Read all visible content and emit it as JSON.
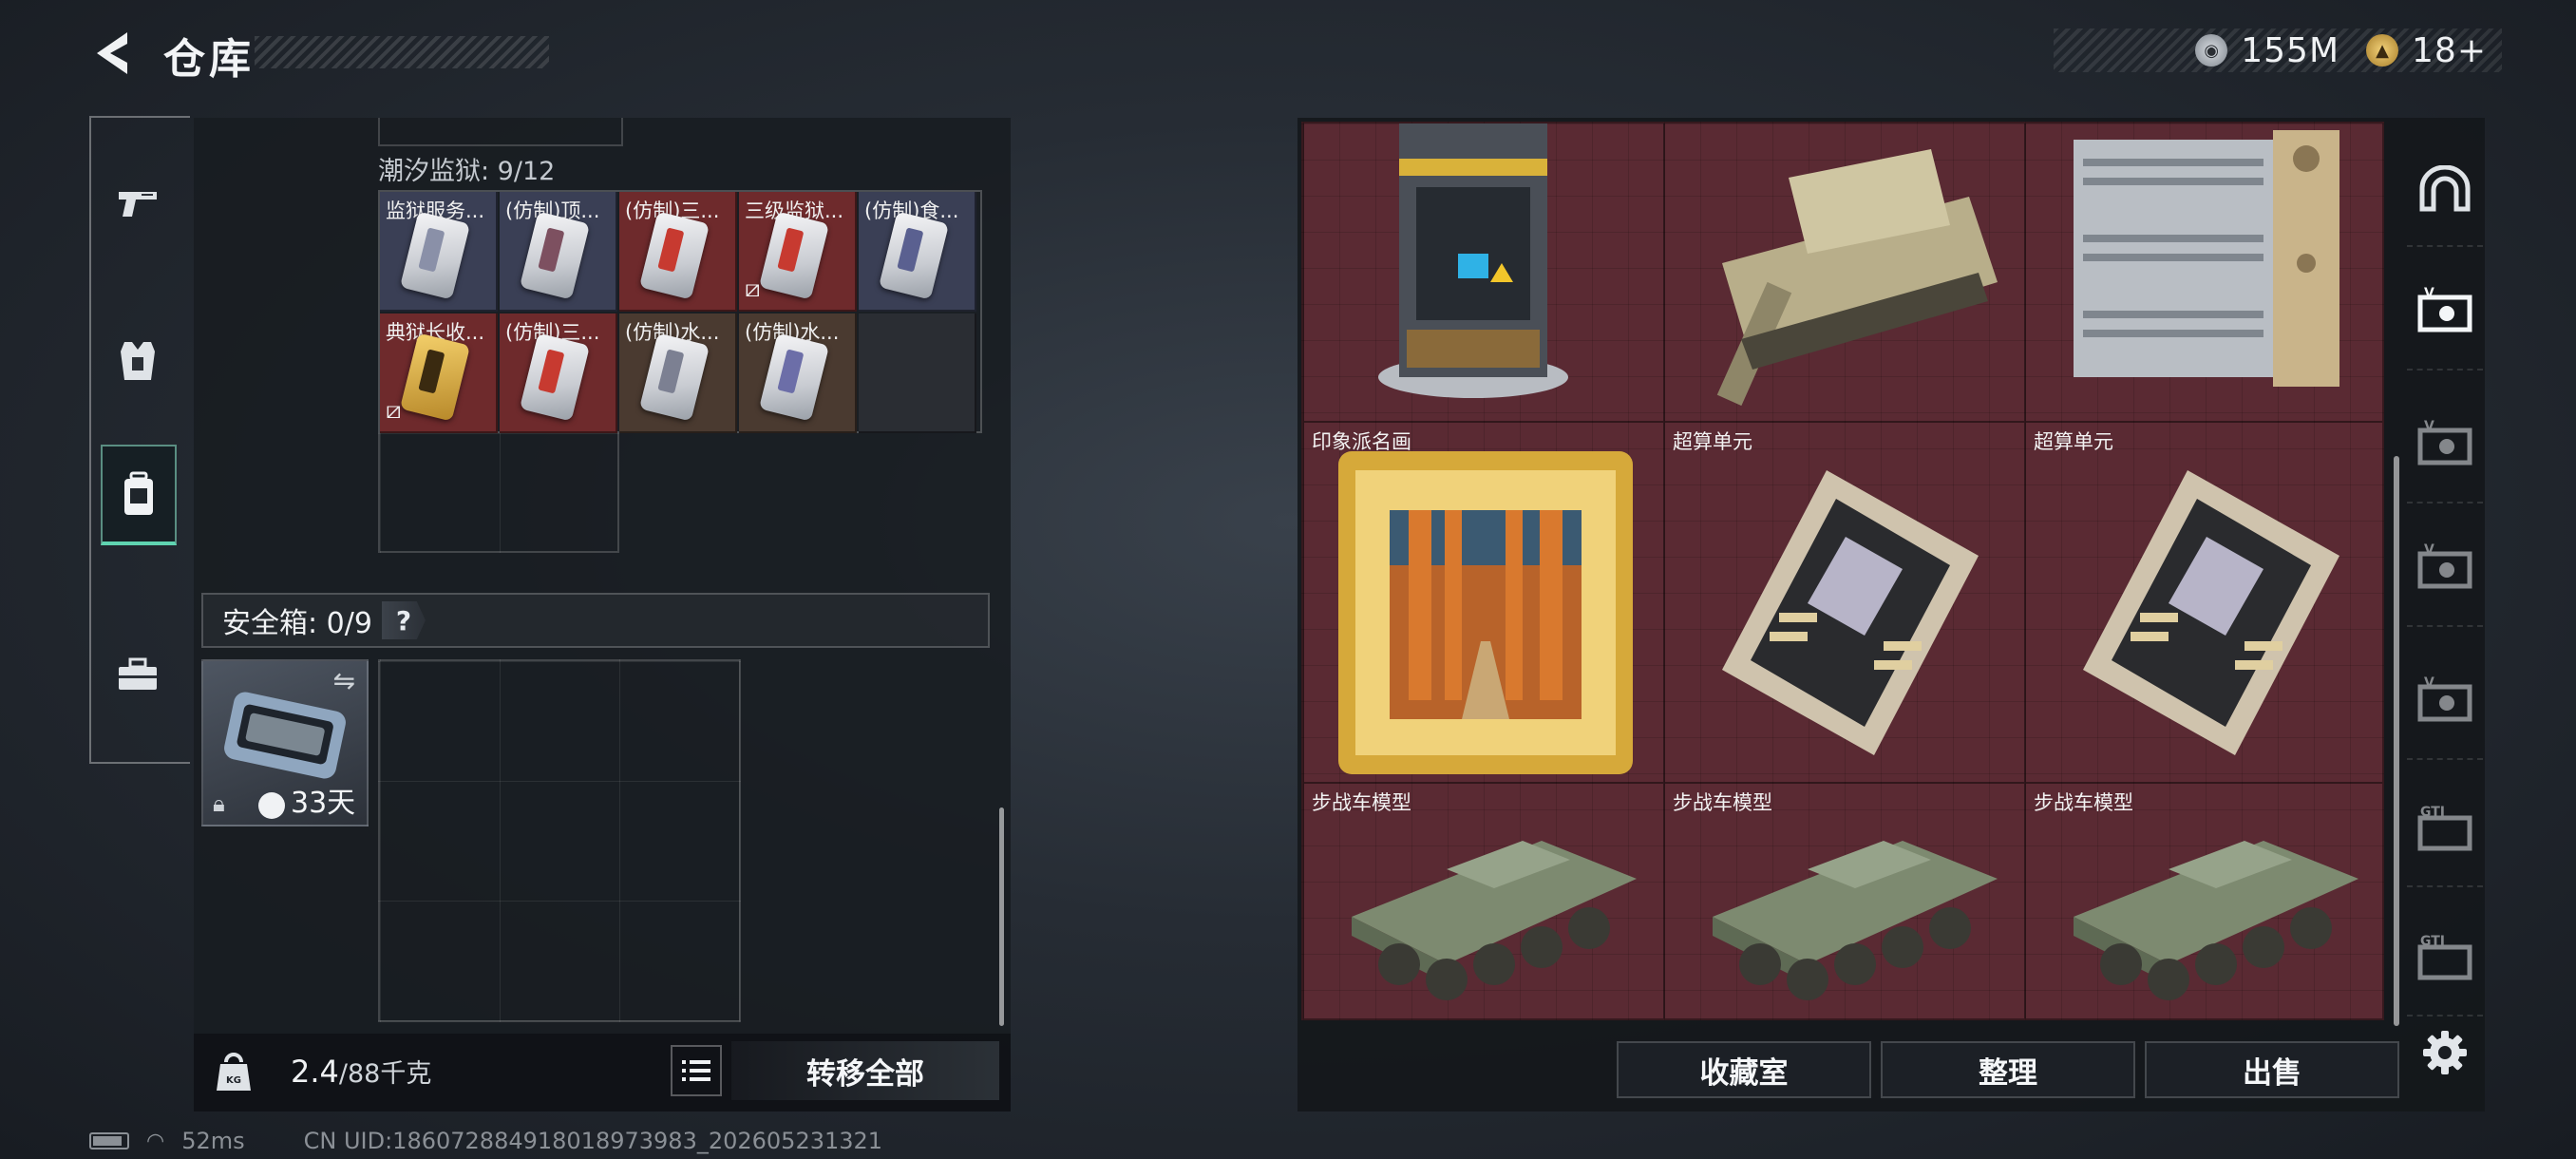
{
  "header": {
    "title": "仓库",
    "currencies": [
      {
        "icon": "coin-icon",
        "value": "155M"
      },
      {
        "icon": "premium-currency-icon",
        "value": "18+"
      }
    ]
  },
  "left_nav": {
    "items": [
      {
        "icon": "pistol-icon",
        "active": false
      },
      {
        "icon": "armor-vest-icon",
        "active": false
      },
      {
        "icon": "backpack-icon",
        "active": true
      },
      {
        "icon": "toolbox-icon",
        "active": false
      }
    ]
  },
  "container": {
    "label": "潮汐监狱: 9/12",
    "items": [
      {
        "label": "监狱服务...",
        "card_color": "#3a3f55",
        "flag": false
      },
      {
        "label": "(仿制)顶...",
        "card_color": "#3a3f55",
        "flag": false
      },
      {
        "label": "(仿制)三...",
        "card_color": "#6e2a2c",
        "flag": false
      },
      {
        "label": "三级监狱...",
        "card_color": "#6e2a2c",
        "flag": true
      },
      {
        "label": "(仿制)食...",
        "card_color": "#3a3f55",
        "flag": false
      },
      {
        "label": "典狱长收...",
        "card_color": "#6e2a2c",
        "flag": true
      },
      {
        "label": "(仿制)三...",
        "card_color": "#6e2a2c",
        "flag": false
      },
      {
        "label": "(仿制)水...",
        "card_color": "#4a3a30",
        "flag": false
      },
      {
        "label": "(仿制)水...",
        "card_color": "#4a3a30",
        "flag": false
      }
    ]
  },
  "safe_box": {
    "title": "安全箱: 0/9",
    "help": "?",
    "time_left": "33天"
  },
  "weight": {
    "current": "2.4",
    "max": "/88千克"
  },
  "transfer_all": "转移全部",
  "stash": {
    "items": [
      {
        "label": "",
        "kind": "reactor"
      },
      {
        "label": "",
        "kind": "tank"
      },
      {
        "label": "",
        "kind": "server-rack"
      },
      {
        "label": "印象派名画",
        "kind": "painting"
      },
      {
        "label": "超算单元",
        "kind": "gpu"
      },
      {
        "label": "超算单元",
        "kind": "gpu"
      },
      {
        "label": "步战车模型",
        "kind": "ifv"
      },
      {
        "label": "步战车模型",
        "kind": "ifv"
      },
      {
        "label": "步战车模型",
        "kind": "ifv"
      }
    ],
    "bg_color": "#5a2a33"
  },
  "actions": {
    "collection": "收藏室",
    "sort": "整理",
    "sell": "出售"
  },
  "right_rail": {
    "items": [
      {
        "icon": "arch-icon",
        "tag": ""
      },
      {
        "icon": "stash-v-active-icon",
        "tag": "V"
      },
      {
        "icon": "stash-v-icon",
        "tag": "V"
      },
      {
        "icon": "stash-v-icon",
        "tag": "V"
      },
      {
        "icon": "stash-v-icon",
        "tag": "V"
      },
      {
        "icon": "gti-stash-icon",
        "tag": "GTI"
      },
      {
        "icon": "gti-stash-icon",
        "tag": "GTI"
      }
    ]
  },
  "status": {
    "ping": "52ms",
    "uid": "CN UID:186072884918018973983_202605231321"
  }
}
